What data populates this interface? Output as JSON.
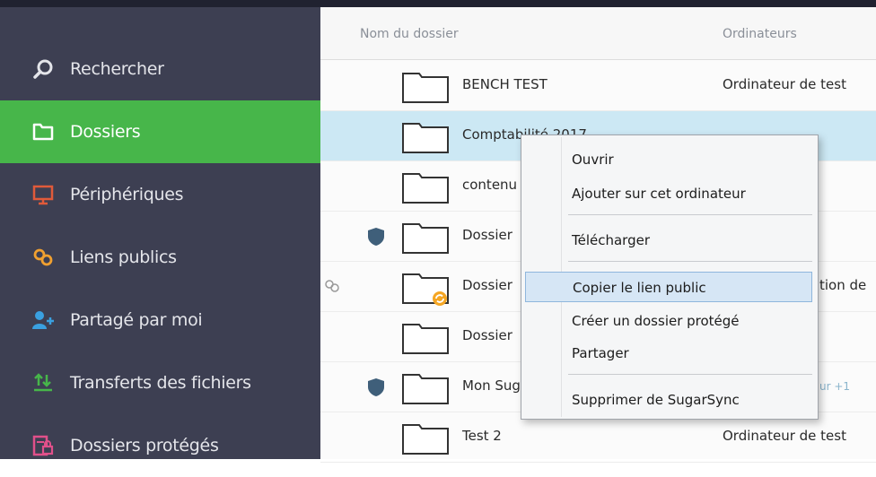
{
  "sidebar": {
    "items": [
      {
        "label": "Rechercher",
        "icon": "search-icon",
        "color": "#e4e5ea",
        "active": false
      },
      {
        "label": "Dossiers",
        "icon": "folder-icon",
        "color": "#ffffff",
        "active": true
      },
      {
        "label": "Périphériques",
        "icon": "monitor-icon",
        "color": "#e05a3a",
        "active": false
      },
      {
        "label": "Liens publics",
        "icon": "link-icon",
        "color": "#f0a030",
        "active": false
      },
      {
        "label": "Partagé par moi",
        "icon": "add-user-icon",
        "color": "#3aa0e0",
        "active": false
      },
      {
        "label": "Transferts des fichiers",
        "icon": "transfer-icon",
        "color": "#47b64a",
        "active": false
      },
      {
        "label": "Dossiers protégés",
        "icon": "protected-folder-icon",
        "color": "#e0508a",
        "active": false
      }
    ]
  },
  "table": {
    "columns": [
      "Nom du dossier",
      "Ordinateurs"
    ],
    "rows": [
      {
        "name": "BENCH TEST",
        "computer": "Ordinateur de test"
      },
      {
        "name": "Comptabilité 2017",
        "computer": ""
      },
      {
        "name": "contenu",
        "computer": ""
      },
      {
        "name": "Dossier",
        "computer": ""
      },
      {
        "name": "Dossier",
        "computer": "tion de"
      },
      {
        "name": "Dossier",
        "computer": ""
      },
      {
        "name": "Mon SugarSync",
        "computer": "ur +1"
      },
      {
        "name": "Test 2",
        "computer": "Ordinateur de test"
      }
    ]
  },
  "context_menu": {
    "items": [
      "Ouvrir",
      "Ajouter sur cet ordinateur",
      "Télécharger",
      "Copier le lien public",
      "Créer un dossier protégé",
      "Partager",
      "Supprimer de SugarSync"
    ]
  },
  "colors": {
    "sidebar_bg": "#3d3f52",
    "active": "#47b64a",
    "selected_row": "#cce8f4",
    "shield": "#3f5f7a"
  }
}
